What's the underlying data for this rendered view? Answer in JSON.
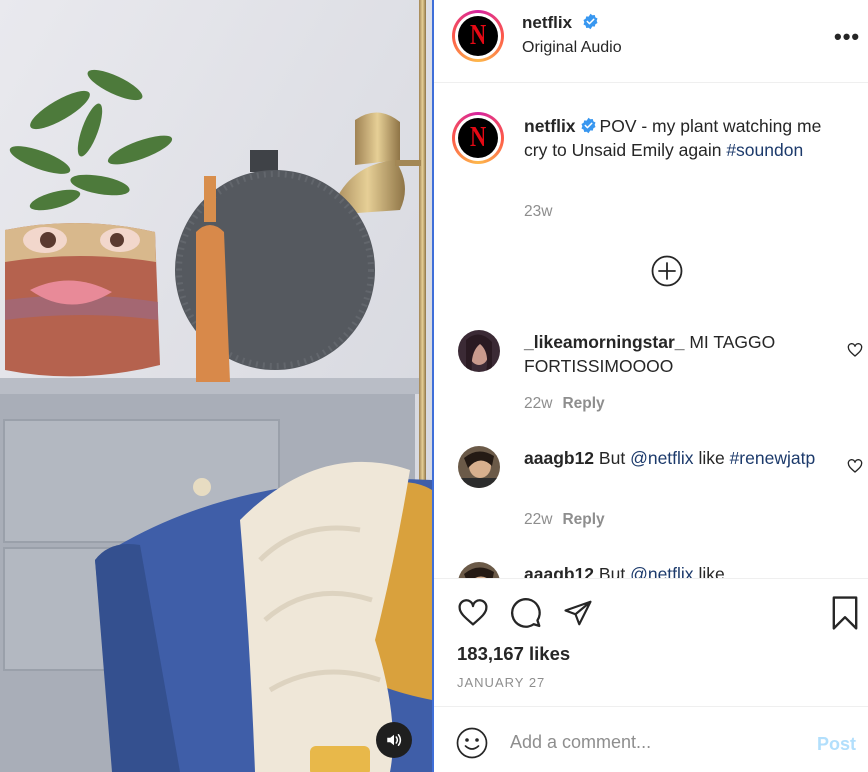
{
  "post": {
    "username": "netflix",
    "audio": "Original Audio",
    "logo_letter": "N",
    "more_label": "•••"
  },
  "caption": {
    "username": "netflix",
    "text": "POV - my plant watching me cry to Unsaid Emily again",
    "hashtag": "#soundon",
    "time": "23w"
  },
  "comments": [
    {
      "username": "_likeamorningstar_",
      "text": "MI TAGGO FORTISSIMOOOO",
      "time": "22w",
      "reply": "Reply"
    },
    {
      "username": "aaagb12",
      "text": "But",
      "mention": "@netflix",
      "text_after": "like",
      "hashtag": "#renewjatp",
      "time": "22w",
      "reply": "Reply"
    },
    {
      "username": "aaagb12",
      "text": "But",
      "mention": "@netflix",
      "text_after": "like"
    }
  ],
  "stats": {
    "likes": "183,167 likes",
    "date": "JANUARY 27"
  },
  "composer": {
    "placeholder": "Add a comment...",
    "post_label": "Post"
  },
  "icons": {
    "verified": "verified-badge-icon",
    "sound": "speaker-icon",
    "load_more": "plus-circle-icon",
    "like": "heart-icon",
    "comment": "comment-bubble-icon",
    "share": "paper-plane-icon",
    "save": "bookmark-icon",
    "emoji": "smiley-icon"
  },
  "colors": {
    "verified_blue": "#3897f0",
    "link": "#1c3a6b",
    "netflix_red": "#e50914",
    "post_disabled": "#b2dffc"
  }
}
